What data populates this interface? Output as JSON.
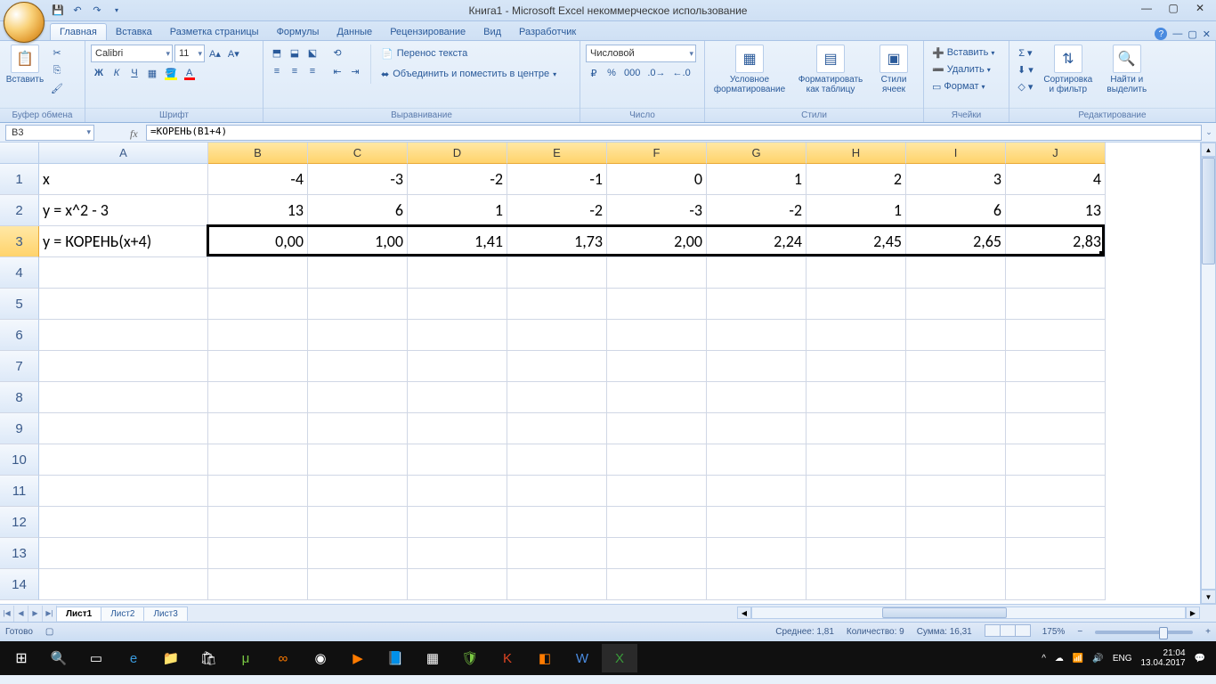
{
  "title": "Книга1 - Microsoft Excel некоммерческое использование",
  "tabs": [
    "Главная",
    "Вставка",
    "Разметка страницы",
    "Формулы",
    "Данные",
    "Рецензирование",
    "Вид",
    "Разработчик"
  ],
  "active_tab": 0,
  "ribbon": {
    "clipboard": {
      "paste": "Вставить",
      "label": "Буфер обмена"
    },
    "font": {
      "name": "Calibri",
      "size": "11",
      "label": "Шрифт"
    },
    "alignment": {
      "wrap": "Перенос текста",
      "merge": "Объединить и поместить в центре",
      "label": "Выравнивание"
    },
    "number": {
      "format": "Числовой",
      "label": "Число"
    },
    "styles": {
      "cond": "Условное\nформатирование",
      "table": "Форматировать\nкак таблицу",
      "cell": "Стили\nячеек",
      "label": "Стили"
    },
    "cells": {
      "insert": "Вставить",
      "delete": "Удалить",
      "format": "Формат",
      "label": "Ячейки"
    },
    "editing": {
      "sort": "Сортировка\nи фильтр",
      "find": "Найти и\nвыделить",
      "label": "Редактирование"
    }
  },
  "name_box": "B3",
  "formula": "=КОРЕНЬ(B1+4)",
  "columns": [
    "A",
    "B",
    "C",
    "D",
    "E",
    "F",
    "G",
    "H",
    "I",
    "J"
  ],
  "col_widths": {
    "A": 190,
    "other": 112
  },
  "row_labels": [
    "1",
    "2",
    "3",
    "4",
    "5",
    "6",
    "7",
    "8",
    "9",
    "10",
    "11",
    "12",
    "13",
    "14"
  ],
  "data": {
    "A1": "x",
    "B1": "-4",
    "C1": "-3",
    "D1": "-2",
    "E1": "-1",
    "F1": "0",
    "G1": "1",
    "H1": "2",
    "I1": "3",
    "J1": "4",
    "A2": "y = x^2 - 3",
    "B2": "13",
    "C2": "6",
    "D2": "1",
    "E2": "-2",
    "F2": "-3",
    "G2": "-2",
    "H2": "1",
    "I2": "6",
    "J2": "13",
    "A3": "y = КОРЕНЬ(x+4)",
    "B3": "0,00",
    "C3": "1,00",
    "D3": "1,41",
    "E3": "1,73",
    "F3": "2,00",
    "G3": "2,24",
    "H3": "2,45",
    "I3": "2,65",
    "J3": "2,83"
  },
  "selection": {
    "row": 3,
    "col_start": "B",
    "col_end": "J"
  },
  "sheet_tabs": [
    "Лист1",
    "Лист2",
    "Лист3"
  ],
  "active_sheet": 0,
  "status": {
    "ready": "Готово",
    "avg": "Среднее: 1,81",
    "count": "Количество: 9",
    "sum": "Сумма: 16,31",
    "zoom": "175%"
  },
  "tray": {
    "lang": "ENG",
    "time": "21:04",
    "date": "13.04.2017"
  }
}
